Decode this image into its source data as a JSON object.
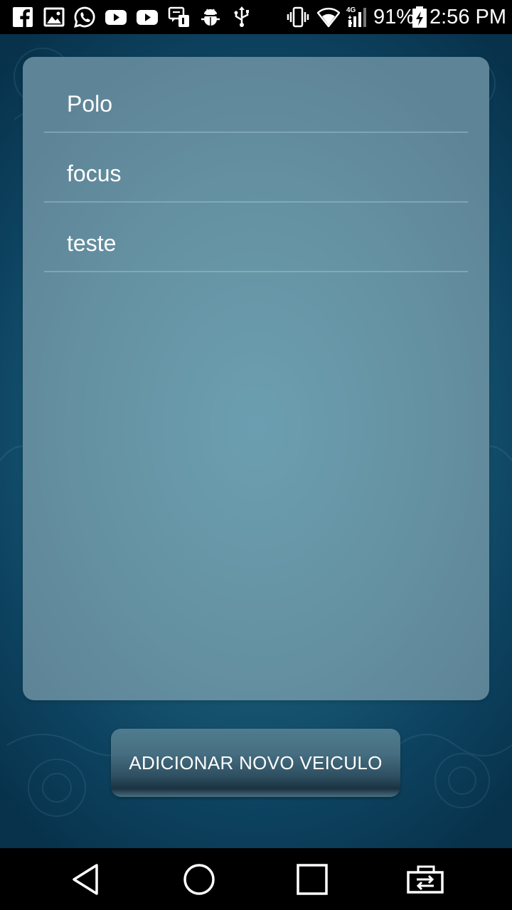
{
  "status_bar": {
    "notification_icons": [
      "facebook-icon",
      "gallery-icon",
      "whatsapp-icon",
      "youtube-icon",
      "youtube-icon",
      "sim-card-icon",
      "android-debug-icon",
      "usb-icon"
    ],
    "system_icons": [
      "vibrate-icon",
      "wifi-icon",
      "signal-4g-icon",
      "battery-charging-icon"
    ],
    "network_label": "4G",
    "battery": "91%",
    "time": "2:56 PM"
  },
  "vehicles": {
    "items": [
      {
        "label": "Polo"
      },
      {
        "label": "focus"
      },
      {
        "label": "teste"
      }
    ]
  },
  "actions": {
    "add_vehicle_label": "ADICIONAR NOVO VEICULO"
  },
  "nav_bar": {
    "buttons": [
      "back-icon",
      "home-icon",
      "recents-icon",
      "dual-window-icon"
    ]
  },
  "colors": {
    "background": "#1a5a75",
    "card": "#6592a3",
    "text": "#ffffff",
    "status_bar": "#000000"
  }
}
